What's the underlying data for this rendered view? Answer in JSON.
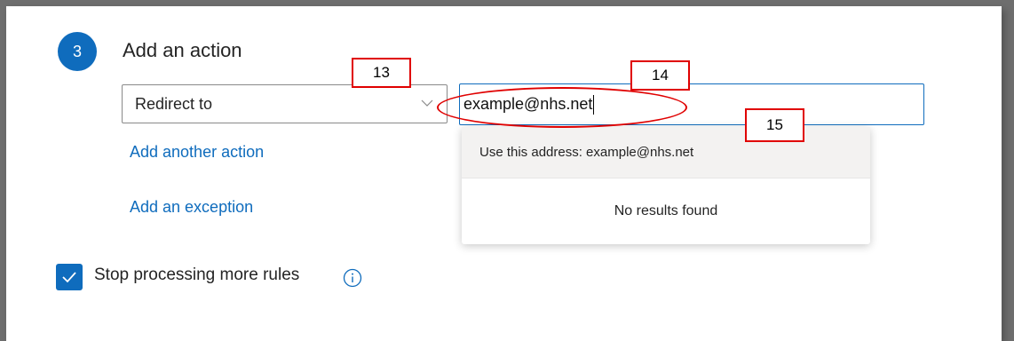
{
  "step": {
    "number": "3",
    "title": "Add an action"
  },
  "action_select": {
    "value": "Redirect to"
  },
  "redirect_input": {
    "value": "example@nhs.net"
  },
  "links": {
    "add_action": "Add another action",
    "add_exception": "Add an exception"
  },
  "suggestions": {
    "use_address": "Use this address: example@nhs.net",
    "empty": "No results found"
  },
  "stop_processing": {
    "label": "Stop processing more rules",
    "checked": true
  },
  "annotations": {
    "callout_13": "13",
    "callout_14": "14",
    "callout_15": "15"
  },
  "colors": {
    "accent": "#0f6cbd",
    "annotation": "#e00000"
  }
}
